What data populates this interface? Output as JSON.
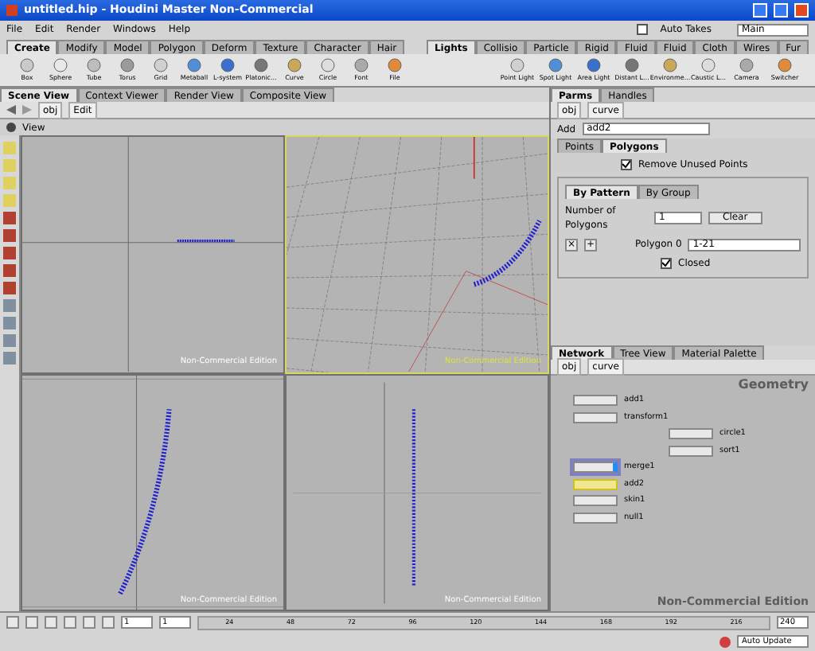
{
  "window": {
    "title": "untitled.hip - Houdini Master Non-Commercial"
  },
  "menu": [
    "File",
    "Edit",
    "Render",
    "Windows",
    "Help"
  ],
  "auto_takes": {
    "label": "Auto Takes",
    "checked": false
  },
  "take": {
    "value": "Main"
  },
  "shelf_tabs_left": [
    {
      "label": "Create",
      "selected": true
    },
    {
      "label": "Modify",
      "selected": false
    },
    {
      "label": "Model",
      "selected": false
    },
    {
      "label": "Polygon",
      "selected": false
    },
    {
      "label": "Deform",
      "selected": false
    },
    {
      "label": "Texture",
      "selected": false
    },
    {
      "label": "Character",
      "selected": false
    },
    {
      "label": "Hair",
      "selected": false
    }
  ],
  "shelf_tabs_right": [
    {
      "label": "Lights",
      "selected": true
    },
    {
      "label": "Collisio",
      "selected": false
    },
    {
      "label": "Particle",
      "selected": false
    },
    {
      "label": "Rigid",
      "selected": false
    },
    {
      "label": "Fluid",
      "selected": false
    },
    {
      "label": "Fluid",
      "selected": false
    },
    {
      "label": "Cloth",
      "selected": false
    },
    {
      "label": "Wires",
      "selected": false
    },
    {
      "label": "Fur",
      "selected": false
    }
  ],
  "shelf_tools_left": [
    "Box",
    "Sphere",
    "Tube",
    "Torus",
    "Grid",
    "Metaball",
    "L-system",
    "Platonic...",
    "Curve",
    "Circle",
    "Font",
    "File"
  ],
  "shelf_tools_right": [
    "Point Light",
    "Spot Light",
    "Area Light",
    "Distant L...",
    "Environme...",
    "Caustic L...",
    "Camera",
    "Switcher"
  ],
  "pane_tabs": [
    {
      "label": "Scene View",
      "selected": true
    },
    {
      "label": "Context Viewer",
      "selected": false
    },
    {
      "label": "Render View",
      "selected": false
    },
    {
      "label": "Composite View",
      "selected": false
    }
  ],
  "scene_path": [
    "obj",
    "Edit"
  ],
  "view_label": "View",
  "viewports": [
    {
      "watermark": "Non-Commercial Edition",
      "highlighted": false
    },
    {
      "watermark": "Non-Commercial Edition",
      "highlighted": true
    },
    {
      "watermark": "Non-Commercial Edition",
      "highlighted": false
    },
    {
      "watermark": "Non-Commercial Edition",
      "highlighted": false
    }
  ],
  "param_tabs": [
    {
      "label": "Parms",
      "selected": true
    },
    {
      "label": "Handles",
      "selected": false
    }
  ],
  "param_path": [
    "obj",
    "curve"
  ],
  "node": {
    "type": "Add",
    "name": "add2"
  },
  "sub_tabs": [
    {
      "label": "Points",
      "selected": false
    },
    {
      "label": "Polygons",
      "selected": true
    }
  ],
  "remove_unused": {
    "label": "Remove Unused Points",
    "checked": true
  },
  "group_tabs": [
    {
      "label": "By Pattern",
      "selected": true
    },
    {
      "label": "By Group",
      "selected": false
    }
  ],
  "num_polygons": {
    "label": "Number of Polygons",
    "value": "1",
    "clear": "Clear"
  },
  "multi_buttons": [
    "×",
    "+"
  ],
  "polygon": {
    "label": "Polygon 0",
    "value": "1-21"
  },
  "closed": {
    "label": "Closed",
    "checked": true
  },
  "net_tabs": [
    {
      "label": "Network",
      "selected": true
    },
    {
      "label": "Tree View",
      "selected": false
    },
    {
      "label": "Material Palette",
      "selected": false
    }
  ],
  "net_path": [
    "obj",
    "curve"
  ],
  "net_context": "Geometry",
  "nodes": [
    {
      "name": "add1",
      "selected": false,
      "display": false
    },
    {
      "name": "transform1",
      "selected": false,
      "display": false
    },
    {
      "name": "circle1",
      "selected": false,
      "display": false
    },
    {
      "name": "sort1",
      "selected": false,
      "display": false
    },
    {
      "name": "merge1",
      "selected": false,
      "display": true
    },
    {
      "name": "add2",
      "selected": true,
      "display": false
    },
    {
      "name": "skin1",
      "selected": false,
      "display": false
    },
    {
      "name": "null1",
      "selected": false,
      "display": false
    }
  ],
  "net_watermark": "Non-Commercial Edition",
  "timeline": {
    "start": "1",
    "end": "1",
    "ticks": [
      "24",
      "48",
      "72",
      "96",
      "120",
      "144",
      "168",
      "192",
      "216"
    ],
    "frame": "240"
  },
  "status": {
    "update": "Auto Update"
  }
}
